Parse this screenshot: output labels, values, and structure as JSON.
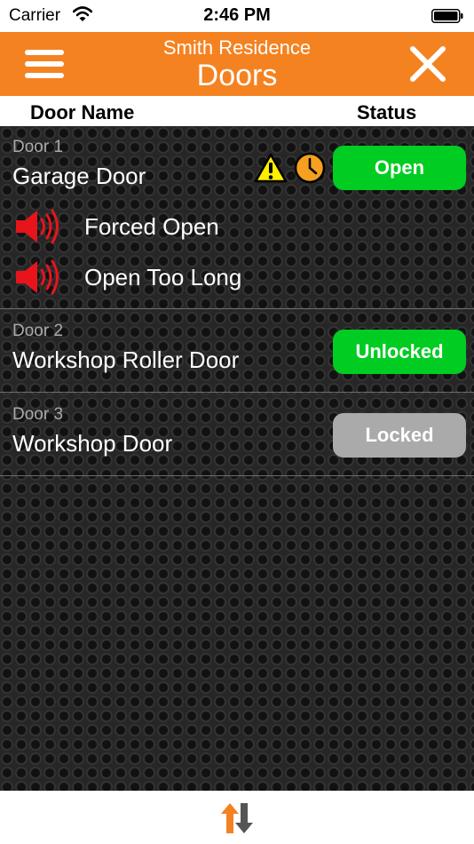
{
  "status_bar": {
    "carrier": "Carrier",
    "time": "2:46 PM"
  },
  "header": {
    "subtitle": "Smith Residence",
    "title": "Doors"
  },
  "columns": {
    "name": "Door Name",
    "status": "Status"
  },
  "doors": [
    {
      "number": "Door 1",
      "name": "Garage Door",
      "status": "Open",
      "status_color": "#00cc22",
      "alarms": [
        "Forced Open",
        "Open Too Long"
      ]
    },
    {
      "number": "Door 2",
      "name": "Workshop Roller Door",
      "status": "Unlocked",
      "status_color": "#00cc22"
    },
    {
      "number": "Door 3",
      "name": "Workshop Door",
      "status": "Locked",
      "status_color": "#aaaaaa"
    }
  ],
  "colors": {
    "accent": "#f58220",
    "open": "#00cc22",
    "locked": "#aaaaaa",
    "alarm_red": "#e8141c",
    "warning_yellow": "#ffee00"
  },
  "icons": {
    "menu": "hamburger-menu-icon",
    "close": "close-icon",
    "warning": "warning-triangle-icon",
    "clock": "clock-icon",
    "speaker": "speaker-alarm-icon",
    "sync": "sync-arrows-icon"
  }
}
